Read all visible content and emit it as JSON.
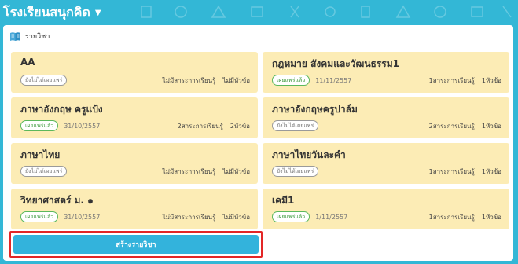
{
  "app": {
    "title": "โรงเรียนสนุกคิด"
  },
  "panel": {
    "title": "รายวิชา"
  },
  "subjects": [
    {
      "name": "AA",
      "status": "ยังไม่ได้เผยแพร่",
      "status_type": "draft",
      "date": "",
      "lessons": "ไม่มีสาระการเรียนรู้",
      "topics": "ไม่มีหัวข้อ"
    },
    {
      "name": "กฎหมาย สังคมและวัฒนธรรม1",
      "status": "เผยแพร่แล้ว",
      "status_type": "published",
      "date": "11/11/2557",
      "lessons": "1สาระการเรียนรู้",
      "topics": "1หัวข้อ"
    },
    {
      "name": "ภาษาอังกฤษ ครูแป้ง",
      "status": "เผยแพร่แล้ว",
      "status_type": "published",
      "date": "31/10/2557",
      "lessons": "2สาระการเรียนรู้",
      "topics": "2หัวข้อ"
    },
    {
      "name": "ภาษาอังกฤษครูปาล์ม",
      "status": "ยังไม่ได้เผยแพร่",
      "status_type": "draft",
      "date": "",
      "lessons": "2สาระการเรียนรู้",
      "topics": "1หัวข้อ"
    },
    {
      "name": "ภาษาไทย",
      "status": "ยังไม่ได้เผยแพร่",
      "status_type": "draft",
      "date": "",
      "lessons": "ไม่มีสาระการเรียนรู้",
      "topics": "ไม่มีหัวข้อ"
    },
    {
      "name": "ภาษาไทยวันละคำ",
      "status": "ยังไม่ได้เผยแพร่",
      "status_type": "draft",
      "date": "",
      "lessons": "1สาระการเรียนรู้",
      "topics": "1หัวข้อ"
    },
    {
      "name": "วิทยาศาสตร์ ม. ๑",
      "status": "เผยแพร่แล้ว",
      "status_type": "published",
      "date": "31/10/2557",
      "lessons": "ไม่มีสาระการเรียนรู้",
      "topics": "ไม่มีหัวข้อ"
    },
    {
      "name": "เคมี1",
      "status": "เผยแพร่แล้ว",
      "status_type": "published",
      "date": "1/11/2557",
      "lessons": "1สาระการเรียนรู้",
      "topics": "1หัวข้อ"
    }
  ],
  "actions": {
    "create_subject": "สร้างรายวิชา"
  },
  "icons": {
    "menu_caret": "chevron-down-icon",
    "panel": "book-icon"
  },
  "colors": {
    "header_bg": "#33b7d6",
    "card_bg": "#fcecb5",
    "button_bg": "#33b3dc",
    "highlight": "#e32626"
  }
}
